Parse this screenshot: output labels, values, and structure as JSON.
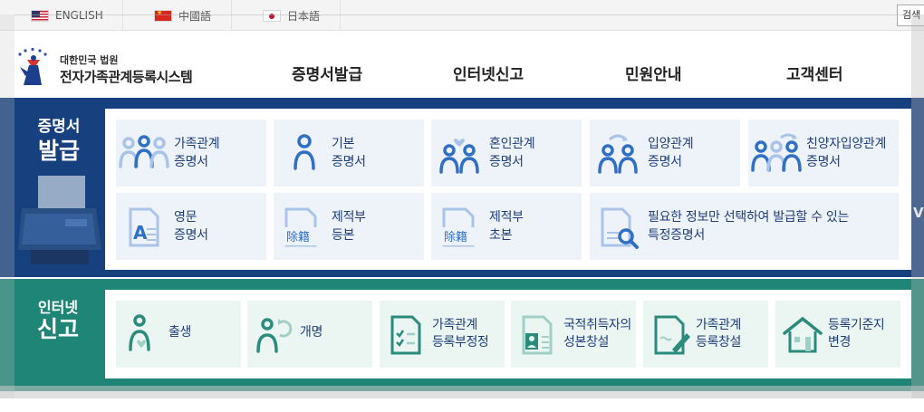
{
  "languages": [
    {
      "label": "ENGLISH"
    },
    {
      "label": "中國語"
    },
    {
      "label": "日本語"
    }
  ],
  "search_label": "검색",
  "logo": {
    "top": "대한민국 법원",
    "title": "전자가족관계등록시스템"
  },
  "nav": [
    {
      "label": "증명서발급"
    },
    {
      "label": "인터넷신고"
    },
    {
      "label": "민원안내"
    },
    {
      "label": "고객센터"
    }
  ],
  "certificates": {
    "title_line1": "증명서",
    "title_line2": "발급",
    "edge_text": "V",
    "row1": [
      {
        "line1": "가족관계",
        "line2": "증명서",
        "icon": "family-icon"
      },
      {
        "line1": "기본",
        "line2": "증명서",
        "icon": "person-icon"
      },
      {
        "line1": "혼인관계",
        "line2": "증명서",
        "icon": "couple-heart-icon"
      },
      {
        "line1": "입양관계",
        "line2": "증명서",
        "icon": "adoption-icon"
      },
      {
        "line1": "친양자입양관계",
        "line2": "증명서",
        "icon": "family-adoption-icon"
      }
    ],
    "row2": [
      {
        "line1": "영문",
        "line2": "증명서",
        "icon": "english-document-icon"
      },
      {
        "line1": "제적부",
        "line2": "등본",
        "icon": "removed-registry-icon",
        "badge": "除籍"
      },
      {
        "line1": "제적부",
        "line2": "초본",
        "icon": "removed-registry-icon",
        "badge": "除籍"
      },
      {
        "line1": "필요한 정보만 선택하여 발급할 수 있는",
        "line2": "특정증명서",
        "icon": "document-search-icon"
      }
    ]
  },
  "reports": {
    "title_line1": "인터넷",
    "title_line2": "신고",
    "items": [
      {
        "line1": "출생",
        "line2": "",
        "icon": "birth-icon"
      },
      {
        "line1": "개명",
        "line2": "",
        "icon": "rename-icon"
      },
      {
        "line1": "가족관계",
        "line2": "등록부정정",
        "icon": "checklist-icon"
      },
      {
        "line1": "국적취득자의",
        "line2": "성본창설",
        "icon": "id-card-icon"
      },
      {
        "line1": "가족관계",
        "line2": "등록창설",
        "icon": "document-edit-icon"
      },
      {
        "line1": "등록기준지",
        "line2": "변경",
        "icon": "house-icon"
      }
    ]
  },
  "colors": {
    "navy": "#17407e",
    "teal": "#1f8576",
    "icon_blue": "#2f6fc4",
    "icon_teal": "#2a8c7c"
  }
}
